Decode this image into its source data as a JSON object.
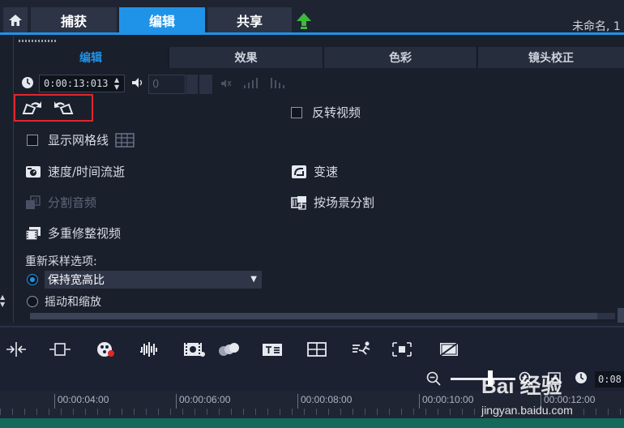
{
  "topbar": {
    "tabs": [
      {
        "label": "捕获",
        "active": false
      },
      {
        "label": "编辑",
        "active": true
      },
      {
        "label": "共享",
        "active": false
      }
    ],
    "project_title": "未命名, 1",
    "accent_color": "#1f93e8"
  },
  "options": {
    "subtabs": [
      {
        "label": "编辑",
        "active": true
      },
      {
        "label": "效果",
        "active": false
      },
      {
        "label": "色彩",
        "active": false
      },
      {
        "label": "镜头校正",
        "active": false
      }
    ],
    "duration_timecode": "0:00:13:013",
    "volume_value": "0",
    "reverse_video": "反转视频",
    "show_grid": "显示网格线",
    "speed_time": "速度/时间流逝",
    "variable_speed": "变速",
    "split_audio": "分割音频",
    "split_by_scene": "按场景分割",
    "multi_trim": "多重修整视频",
    "resample_label": "重新采样选项:",
    "resample_selected": "保持宽高比",
    "pan_zoom": "摇动和缩放",
    "reverse_checked": false,
    "grid_checked": false,
    "highlight_color": "#e2262c"
  },
  "timeline": {
    "timecode": "0:08",
    "ruler_labels": [
      "00:00:04:00",
      "00:00:06:00",
      "00:00:08:00",
      "00:00:10:00",
      "00:00:12:00"
    ]
  },
  "watermark": {
    "brand": "Bai 经验",
    "url": "jingyan.baidu.com"
  }
}
